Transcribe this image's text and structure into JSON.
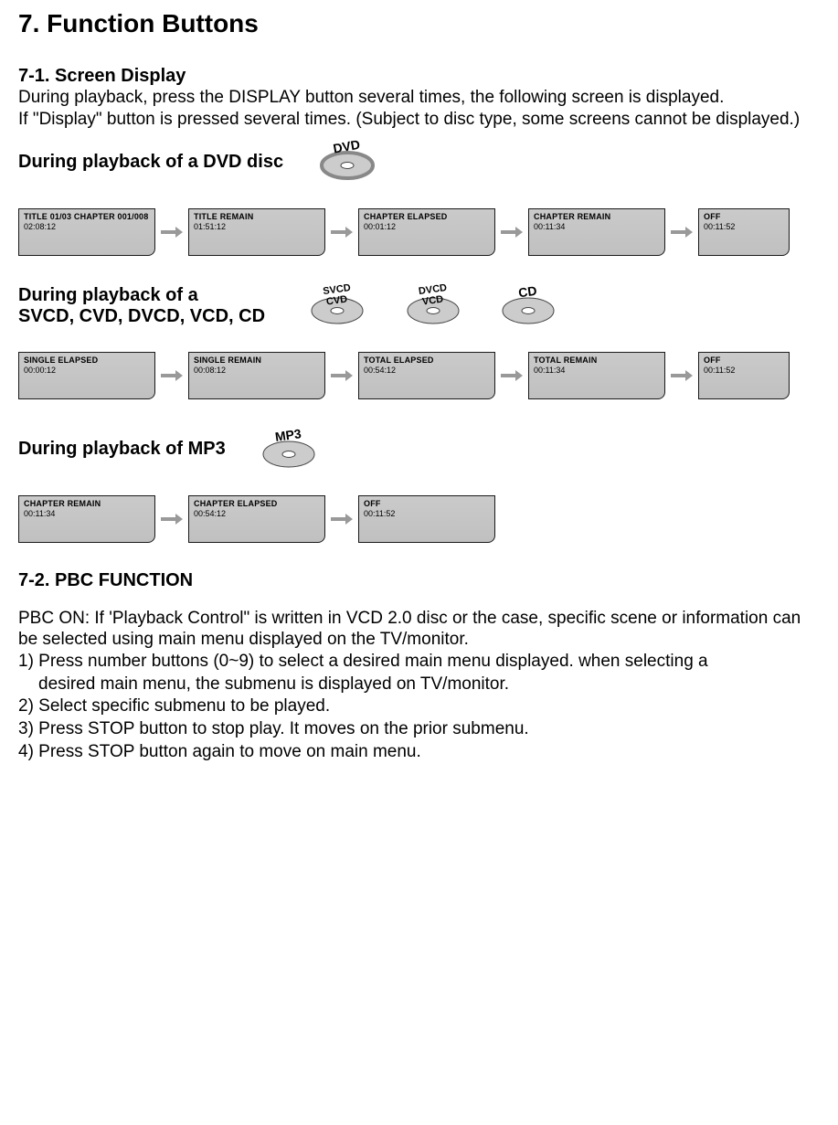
{
  "title": "7. Function Buttons",
  "section1": {
    "heading": "7-1. Screen Display",
    "para1": "During playback, press the DISPLAY button several times, the following screen is displayed.",
    "para2": "If \"Display\" button is pressed several times. (Subject to disc type, some screens cannot be displayed.)",
    "dvd_label": "During playback of a DVD disc",
    "svcd_label1": "During playback of a",
    "svcd_label2": "SVCD, CVD, DVCD, VCD, CD",
    "mp3_label": "During playback of MP3",
    "dvd_boxes": [
      {
        "t": "TITLE 01/03 CHAPTER 001/008",
        "v": "02:08:12"
      },
      {
        "t": "TITLE REMAIN",
        "v": "01:51:12"
      },
      {
        "t": "CHAPTER ELAPSED",
        "v": "00:01:12"
      },
      {
        "t": "CHAPTER REMAIN",
        "v": "00:11:34"
      },
      {
        "t": "OFF",
        "v": "00:11:52"
      }
    ],
    "svcd_boxes": [
      {
        "t": "SINGLE ELAPSED",
        "v": "00:00:12"
      },
      {
        "t": "SINGLE REMAIN",
        "v": "00:08:12"
      },
      {
        "t": "TOTAL ELAPSED",
        "v": "00:54:12"
      },
      {
        "t": "TOTAL REMAIN",
        "v": "00:11:34"
      },
      {
        "t": "OFF",
        "v": "00:11:52"
      }
    ],
    "mp3_boxes": [
      {
        "t": "CHAPTER REMAIN",
        "v": "00:11:34"
      },
      {
        "t": "CHAPTER ELAPSED",
        "v": "00:54:12"
      },
      {
        "t": "OFF",
        "v": "00:11:52"
      }
    ]
  },
  "section2": {
    "heading": "7-2. PBC FUNCTION",
    "intro": "PBC ON: If 'Playback Control\" is written in VCD 2.0 disc or the case, specific scene or information can be selected using main menu displayed on the TV/monitor.",
    "step1a": "1) Press number buttons (0~9) to select a desired main menu displayed. when selecting a",
    "step1b": "desired main menu, the submenu is displayed on TV/monitor.",
    "step2": "2) Select specific submenu to be played.",
    "step3": "3) Press STOP button to stop play. It moves on the prior submenu.",
    "step4": "4) Press STOP button again to move on main menu."
  }
}
